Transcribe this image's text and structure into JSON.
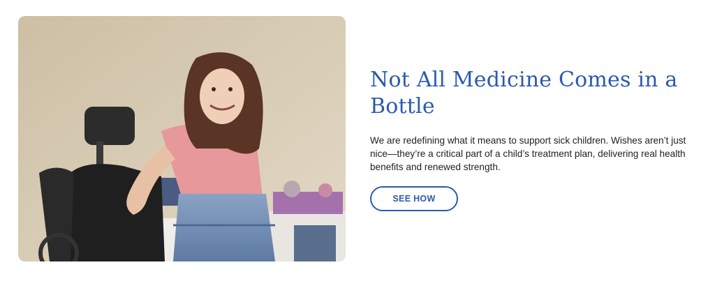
{
  "feature": {
    "headline": "Not All Medicine Comes in a Bottle",
    "body": "We are redefining what it means to support sick children. Wishes aren’t just nice—they’re a critical part of a child’s treatment plan, delivering real health benefits and renewed strength.",
    "cta_label": "SEE HOW"
  },
  "colors": {
    "accent": "#2a5ab0",
    "text": "#1e1e1e",
    "background": "#ffffff"
  }
}
